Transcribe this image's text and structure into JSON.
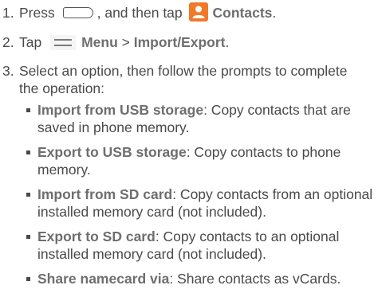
{
  "steps": [
    {
      "number": "1.",
      "text_before": "Press",
      "icon1": "home-key-icon",
      "text_middle": ", and then tap",
      "icon2": "contacts-app-icon",
      "label": "Contacts",
      "text_after": "."
    },
    {
      "number": "2.",
      "text_before": "Tap",
      "icon": "menu-icon",
      "label1": "Menu",
      "separator": " > ",
      "label2": "Import/Export",
      "text_after": "."
    },
    {
      "number": "3.",
      "text": "Select an option, then follow the prompts to complete the operation:"
    }
  ],
  "options": [
    {
      "label": "Import from USB storage",
      "desc": ": Copy contacts that are saved in phone memory."
    },
    {
      "label": "Export to USB storage",
      "desc": ": Copy contacts to phone memory."
    },
    {
      "label": "Import from SD card",
      "desc": ": Copy contacts from an optional installed memory card (not included)."
    },
    {
      "label": "Export to SD card",
      "desc": ": Copy contacts to an optional installed memory card (not included)."
    },
    {
      "label": "Share namecard via",
      "desc": ": Share contacts as vCards."
    }
  ],
  "colors": {
    "body_text": "#4a4a4a",
    "bold_text": "#6e6e6e",
    "contacts_icon_bg": "#f07a2a"
  }
}
